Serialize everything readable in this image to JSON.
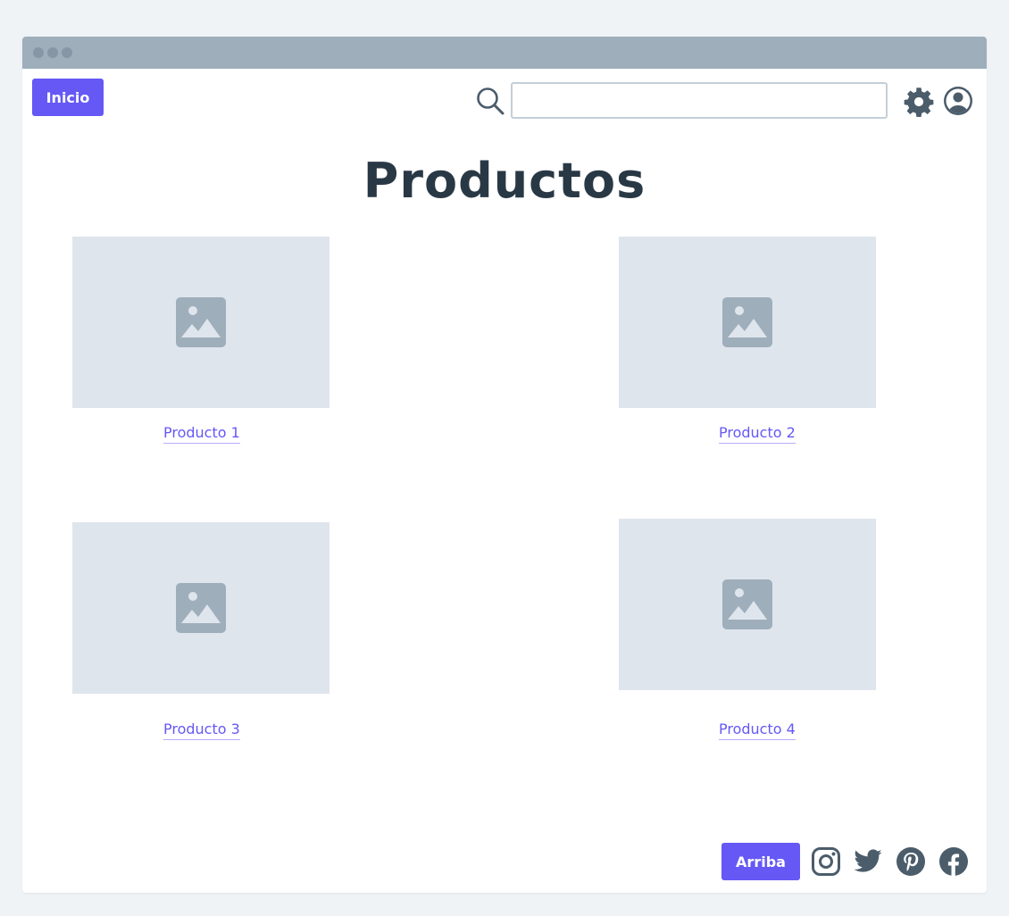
{
  "header": {
    "home_label": "Inicio",
    "search": {
      "value": "",
      "placeholder": ""
    },
    "icons": [
      "search-icon",
      "gear-icon",
      "user-avatar-icon"
    ]
  },
  "main": {
    "title": "Productos",
    "products": [
      {
        "label": "Producto 1",
        "image_icon": "image-placeholder-icon"
      },
      {
        "label": "Producto 2",
        "image_icon": "image-placeholder-icon"
      },
      {
        "label": "Producto 3",
        "image_icon": "image-placeholder-icon"
      },
      {
        "label": "Producto 4",
        "image_icon": "image-placeholder-icon"
      }
    ]
  },
  "footer": {
    "top_label": "Arriba",
    "social_icons": [
      "instagram-icon",
      "twitter-icon",
      "pinterest-icon",
      "facebook-icon"
    ]
  },
  "colors": {
    "accent": "#6558f5",
    "icon_dark": "#4b5c6b",
    "titlebar": "#9eaebb",
    "placeholder_bg": "#dfe5ed",
    "placeholder_icon": "#9eaebb",
    "title_text": "#293845",
    "background": "#eff3f6"
  }
}
